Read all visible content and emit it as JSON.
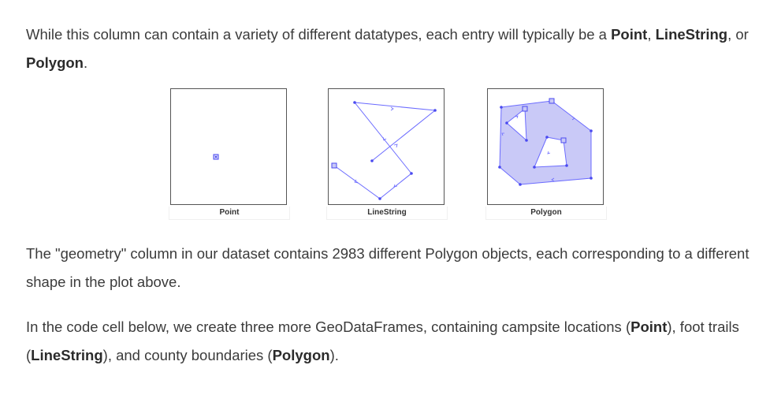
{
  "paragraph1": {
    "text_a": "While this column can contain a variety of different datatypes, each entry will typically be a ",
    "point": "Point",
    "sep1": ", ",
    "linestring": "LineString",
    "sep2": ", or ",
    "polygon": "Polygon",
    "end": "."
  },
  "figure": {
    "captions": {
      "point": "Point",
      "linestring": "LineString",
      "polygon": "Polygon"
    },
    "colors": {
      "stroke": "#6b6bff",
      "fill": "#c9c9f7",
      "vertex": "#4a4af0"
    }
  },
  "paragraph2": {
    "line": "The \"geometry\" column in our dataset contains 2983 different Polygon objects, each corresponding to a different shape in the plot above."
  },
  "paragraph3": {
    "text_a": "In the code cell below, we create three more GeoDataFrames, containing campsite locations (",
    "point": "Point",
    "text_b": "), foot trails (",
    "linestring": "LineString",
    "text_c": "), and county boundaries (",
    "polygon": "Polygon",
    "text_d": ")."
  }
}
